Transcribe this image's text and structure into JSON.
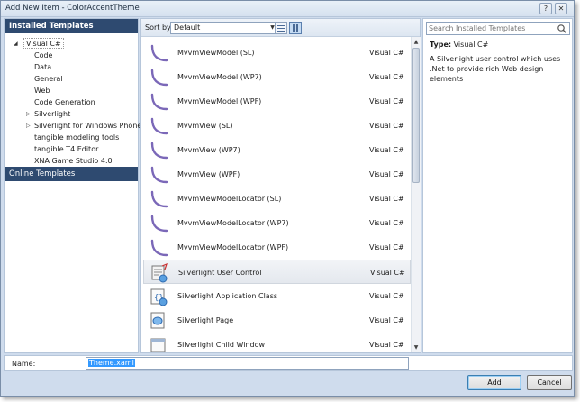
{
  "window": {
    "title": "Add New Item - ColorAccentTheme",
    "help_glyph": "?",
    "close_glyph": "✕"
  },
  "left_panel": {
    "header": "Installed Templates",
    "root": "Visual C#",
    "children": [
      "Code",
      "Data",
      "General",
      "Web",
      "Code Generation"
    ],
    "collapsible": [
      "Silverlight",
      "Silverlight for Windows Phone"
    ],
    "extra": [
      "tangible modeling tools",
      "tangible T4 Editor",
      "XNA Game Studio 4.0"
    ],
    "online": "Online Templates"
  },
  "toolbar": {
    "sort_label": "Sort by:",
    "sort_value": "Default"
  },
  "templates": [
    {
      "name": "MvvmViewModel (SL)",
      "lang": "Visual C#",
      "icon": "arc-icon"
    },
    {
      "name": "MvvmViewModel (WP7)",
      "lang": "Visual C#",
      "icon": "arc-icon"
    },
    {
      "name": "MvvmViewModel (WPF)",
      "lang": "Visual C#",
      "icon": "arc-icon"
    },
    {
      "name": "MvvmView (SL)",
      "lang": "Visual C#",
      "icon": "arc-icon"
    },
    {
      "name": "MvvmView (WP7)",
      "lang": "Visual C#",
      "icon": "arc-icon"
    },
    {
      "name": "MvvmView (WPF)",
      "lang": "Visual C#",
      "icon": "arc-icon"
    },
    {
      "name": "MvvmViewModelLocator (SL)",
      "lang": "Visual C#",
      "icon": "arc-icon"
    },
    {
      "name": "MvvmViewModelLocator (WP7)",
      "lang": "Visual C#",
      "icon": "arc-icon"
    },
    {
      "name": "MvvmViewModelLocator (WPF)",
      "lang": "Visual C#",
      "icon": "arc-icon"
    },
    {
      "name": "Silverlight User Control",
      "lang": "Visual C#",
      "icon": "user-control-icon",
      "selected": true
    },
    {
      "name": "Silverlight Application Class",
      "lang": "Visual C#",
      "icon": "app-class-icon"
    },
    {
      "name": "Silverlight Page",
      "lang": "Visual C#",
      "icon": "page-icon"
    },
    {
      "name": "Silverlight Child Window",
      "lang": "Visual C#",
      "icon": "child-window-icon"
    }
  ],
  "search": {
    "placeholder": "Search Installed Templates"
  },
  "details": {
    "type_label": "Type:",
    "type_value": "Visual C#",
    "description": "A Silverlight user control which uses .Net to provide rich Web design elements"
  },
  "name_field": {
    "label": "Name:",
    "value": "Theme.xaml"
  },
  "buttons": {
    "add": "Add",
    "cancel": "Cancel"
  },
  "colors": {
    "header_bg": "#2e4a70",
    "window_bg": "#cfdced",
    "selection": "#3399ff"
  }
}
